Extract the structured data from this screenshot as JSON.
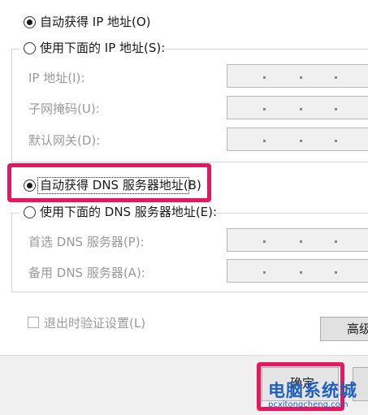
{
  "ip_section": {
    "auto_radio_label": "自动获得 IP 地址(O)",
    "manual_radio_label": "使用下面的 IP 地址(S):",
    "ip_address_label": "IP 地址(I):",
    "subnet_mask_label": "子网掩码(U):",
    "default_gateway_label": "默认网关(D):",
    "separator_dot": "."
  },
  "dns_section": {
    "auto_radio_label": "自动获得 DNS 服务器地址(B)",
    "manual_radio_label": "使用下面的 DNS 服务器地址(E):",
    "preferred_dns_label": "首选 DNS 服务器(P):",
    "alternate_dns_label": "备用 DNS 服务器(A):"
  },
  "validate_on_exit_label": "退出时验证设置(L)",
  "advanced_button_label": "高级",
  "ok_button_label": "确定",
  "watermark": {
    "title": "电脑系统城",
    "url": "pcxitongcheng.com"
  },
  "colors": {
    "highlight": "#e8175d",
    "watermark": "#1f5fbf"
  }
}
